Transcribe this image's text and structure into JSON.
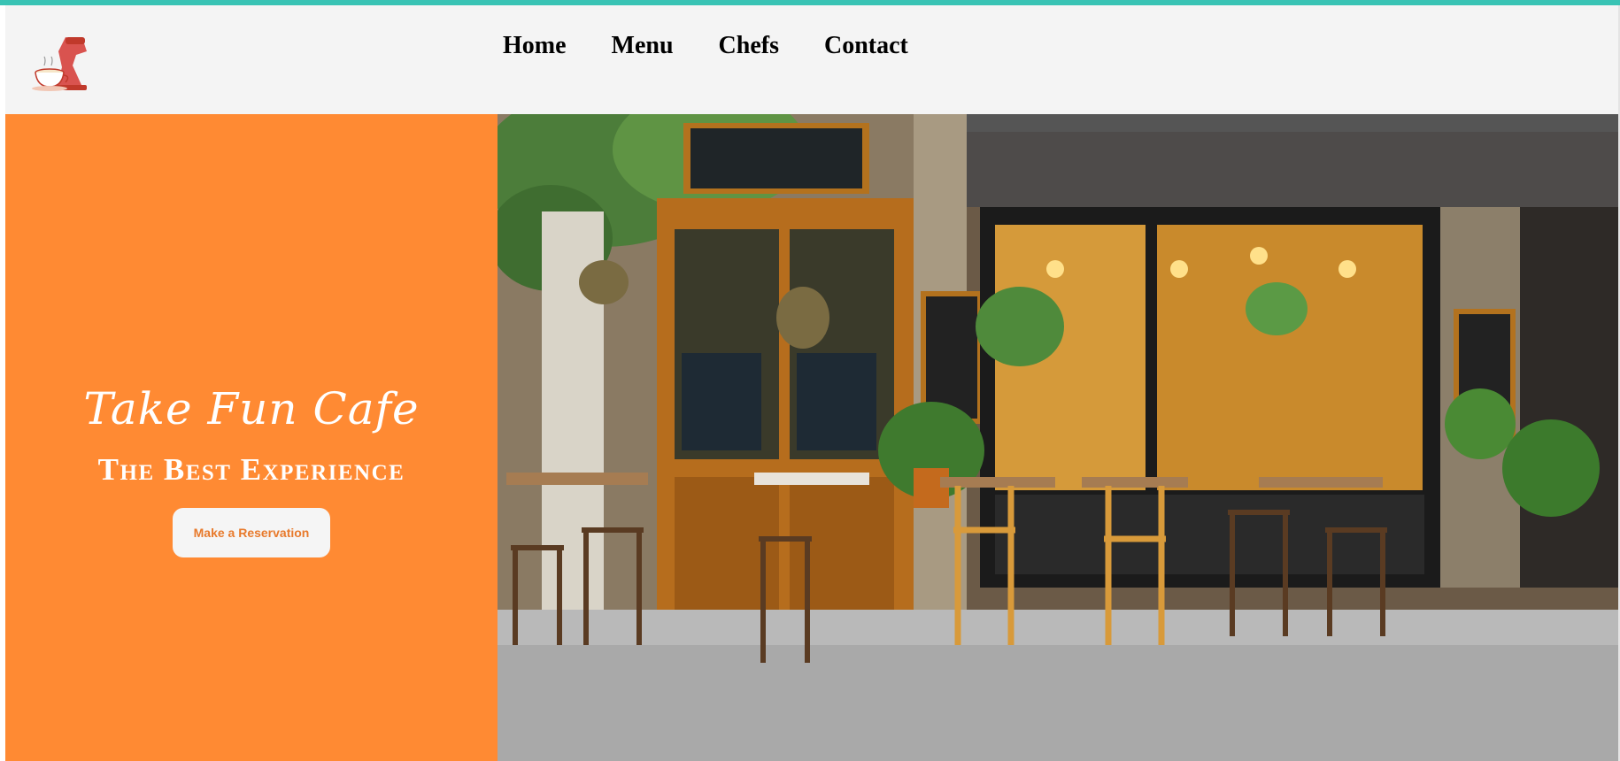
{
  "header": {
    "logo_icon": "stand-mixer-icon",
    "nav": [
      {
        "label": "Home"
      },
      {
        "label": "Menu"
      },
      {
        "label": "Chefs"
      },
      {
        "label": "Contact"
      }
    ]
  },
  "hero": {
    "script_title": "Take Fun Cafe",
    "tagline": "The Best Experience",
    "reservation_button": "Make a Reservation",
    "background_color": "#ff8a33",
    "photo_subject": "cafe-storefront-photo"
  },
  "colors": {
    "accent": "#ff8a33",
    "button_text": "#e87a2c",
    "header_bg": "#f4f4f4"
  }
}
